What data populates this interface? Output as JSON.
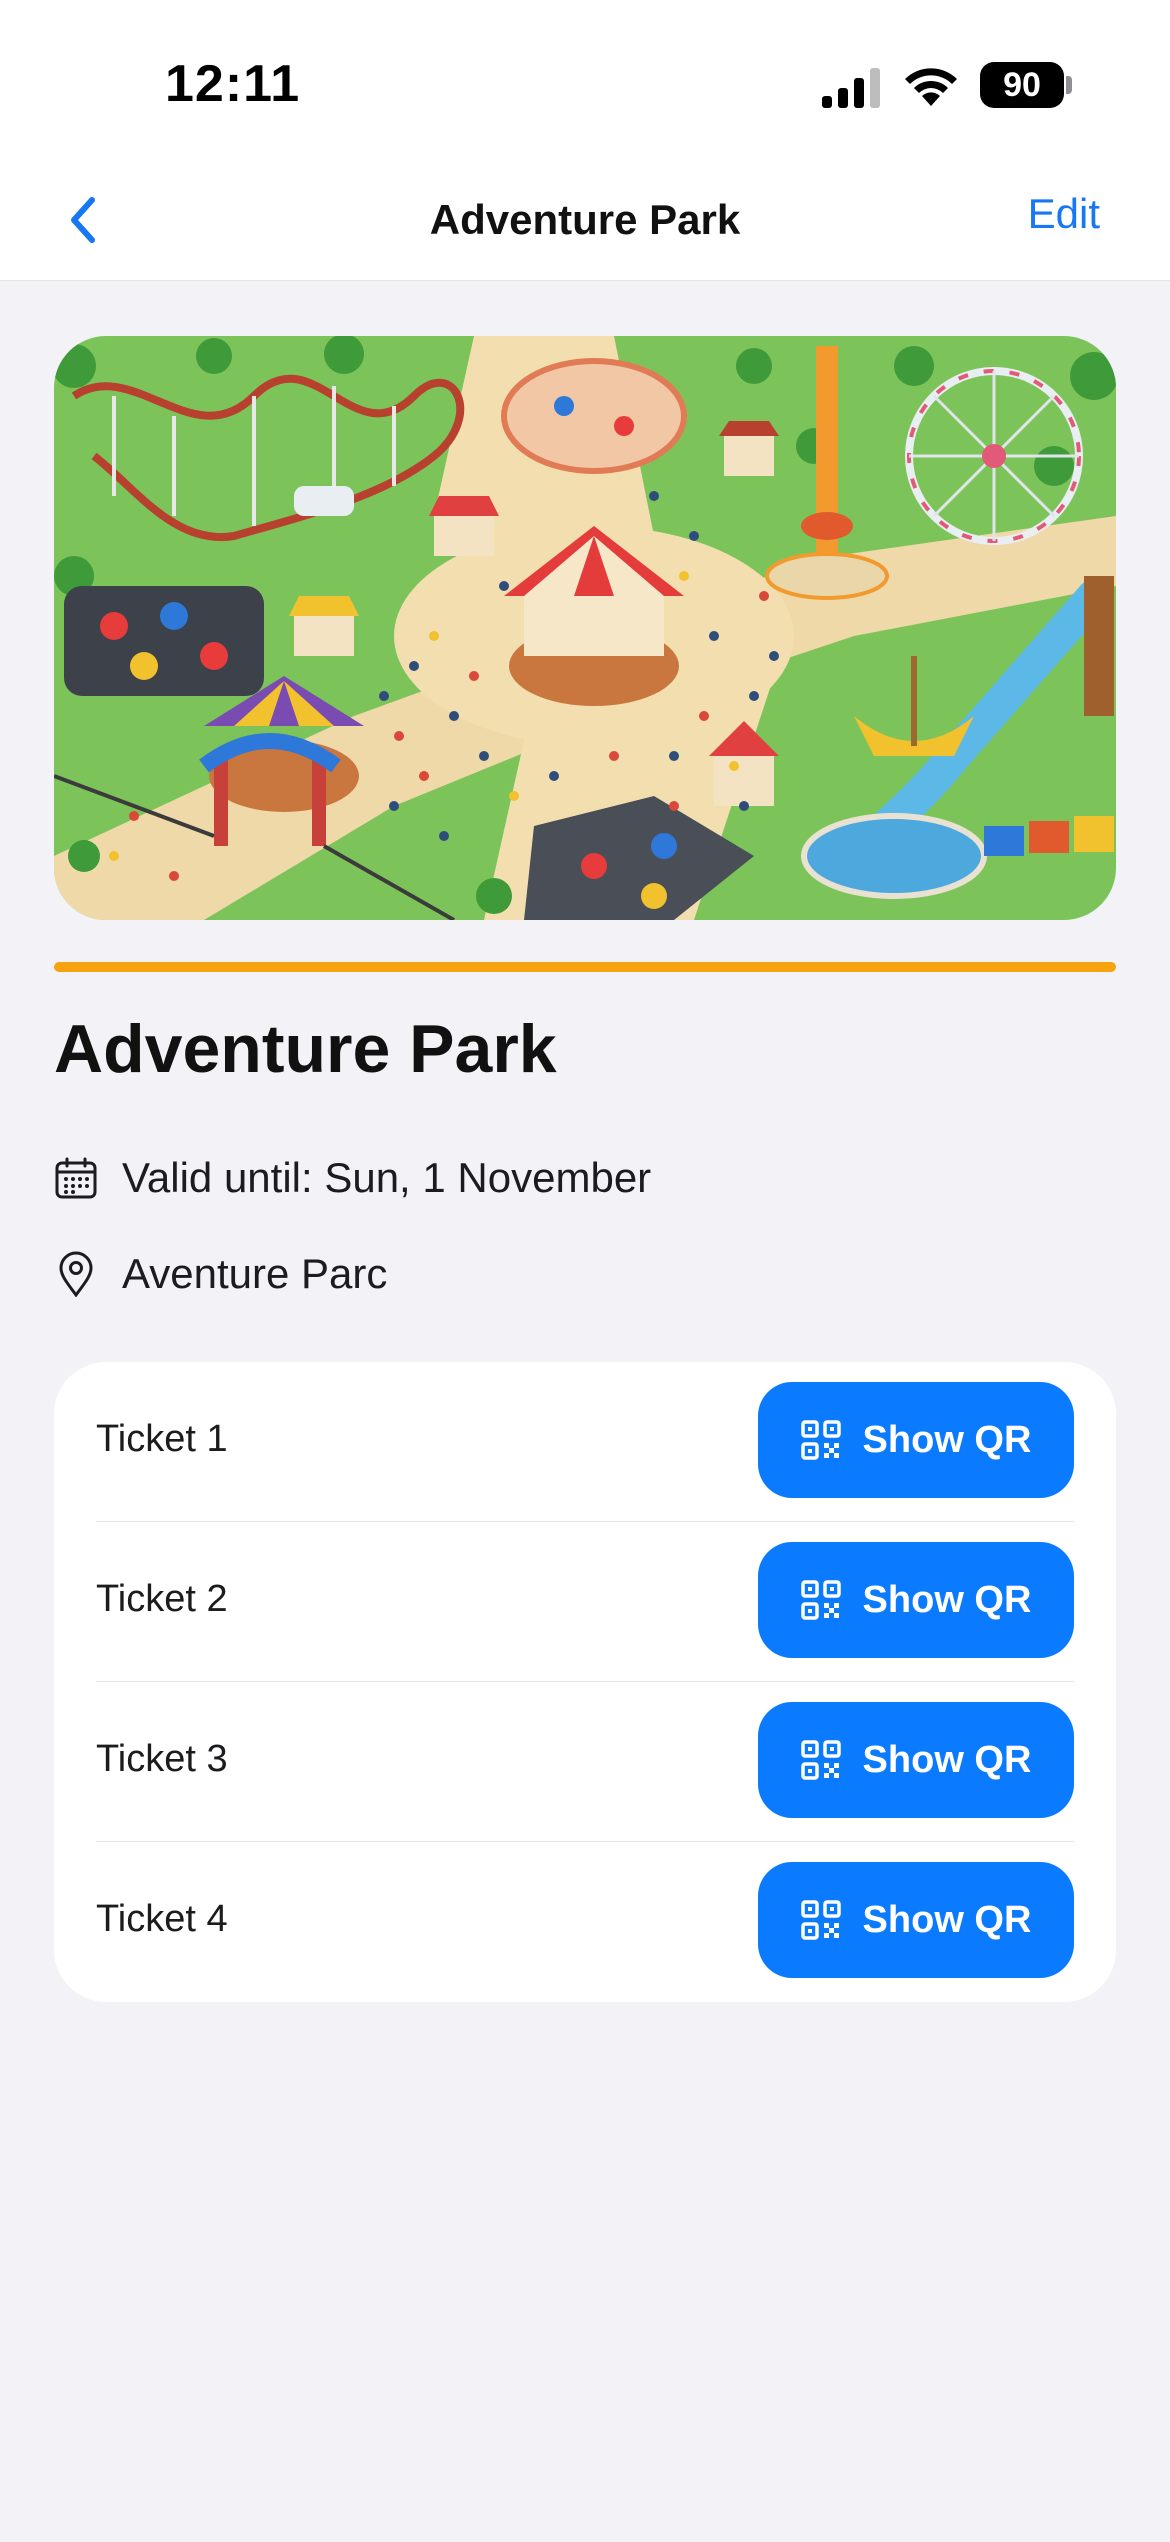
{
  "status_bar": {
    "time": "12:11",
    "battery": "90"
  },
  "nav": {
    "title": "Adventure Park",
    "edit_label": "Edit",
    "back_icon": "chevron-left-icon"
  },
  "hero": {
    "alt": "Adventure Park"
  },
  "accent_color": "#f7a30f",
  "details": {
    "title": "Adventure Park",
    "valid_until": "Valid until: Sun, 1 November",
    "location": "Aventure Parc"
  },
  "tickets": [
    {
      "label": "Ticket 1",
      "button": "Show QR"
    },
    {
      "label": "Ticket 2",
      "button": "Show QR"
    },
    {
      "label": "Ticket 3",
      "button": "Show QR"
    },
    {
      "label": "Ticket 4",
      "button": "Show QR"
    }
  ],
  "colors": {
    "primary": "#0a7aff",
    "link": "#1877f2",
    "background": "#f2f2f7"
  }
}
